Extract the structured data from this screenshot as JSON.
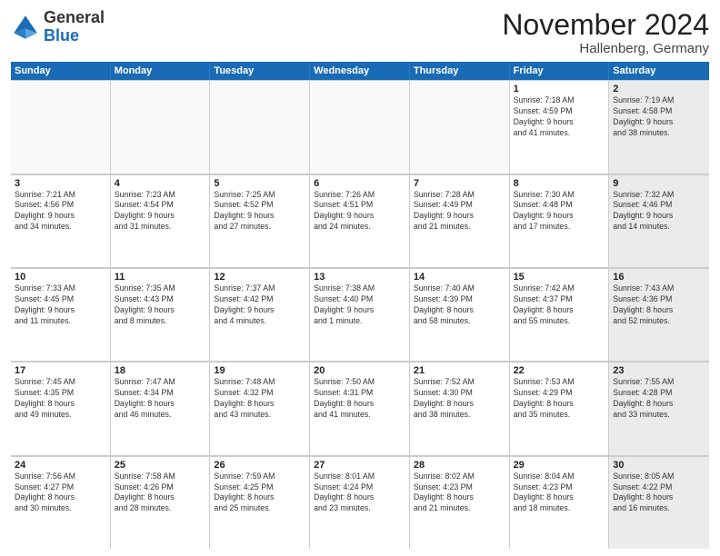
{
  "header": {
    "logo_general": "General",
    "logo_blue": "Blue",
    "month_title": "November 2024",
    "location": "Hallenberg, Germany"
  },
  "days_of_week": [
    "Sunday",
    "Monday",
    "Tuesday",
    "Wednesday",
    "Thursday",
    "Friday",
    "Saturday"
  ],
  "weeks": [
    [
      {
        "day": "",
        "info": "",
        "shaded": false,
        "empty": true
      },
      {
        "day": "",
        "info": "",
        "shaded": false,
        "empty": true
      },
      {
        "day": "",
        "info": "",
        "shaded": false,
        "empty": true
      },
      {
        "day": "",
        "info": "",
        "shaded": false,
        "empty": true
      },
      {
        "day": "",
        "info": "",
        "shaded": false,
        "empty": true
      },
      {
        "day": "1",
        "info": "Sunrise: 7:18 AM\nSunset: 4:59 PM\nDaylight: 9 hours\nand 41 minutes.",
        "shaded": false,
        "empty": false
      },
      {
        "day": "2",
        "info": "Sunrise: 7:19 AM\nSunset: 4:58 PM\nDaylight: 9 hours\nand 38 minutes.",
        "shaded": true,
        "empty": false
      }
    ],
    [
      {
        "day": "3",
        "info": "Sunrise: 7:21 AM\nSunset: 4:56 PM\nDaylight: 9 hours\nand 34 minutes.",
        "shaded": false,
        "empty": false
      },
      {
        "day": "4",
        "info": "Sunrise: 7:23 AM\nSunset: 4:54 PM\nDaylight: 9 hours\nand 31 minutes.",
        "shaded": false,
        "empty": false
      },
      {
        "day": "5",
        "info": "Sunrise: 7:25 AM\nSunset: 4:52 PM\nDaylight: 9 hours\nand 27 minutes.",
        "shaded": false,
        "empty": false
      },
      {
        "day": "6",
        "info": "Sunrise: 7:26 AM\nSunset: 4:51 PM\nDaylight: 9 hours\nand 24 minutes.",
        "shaded": false,
        "empty": false
      },
      {
        "day": "7",
        "info": "Sunrise: 7:28 AM\nSunset: 4:49 PM\nDaylight: 9 hours\nand 21 minutes.",
        "shaded": false,
        "empty": false
      },
      {
        "day": "8",
        "info": "Sunrise: 7:30 AM\nSunset: 4:48 PM\nDaylight: 9 hours\nand 17 minutes.",
        "shaded": false,
        "empty": false
      },
      {
        "day": "9",
        "info": "Sunrise: 7:32 AM\nSunset: 4:46 PM\nDaylight: 9 hours\nand 14 minutes.",
        "shaded": true,
        "empty": false
      }
    ],
    [
      {
        "day": "10",
        "info": "Sunrise: 7:33 AM\nSunset: 4:45 PM\nDaylight: 9 hours\nand 11 minutes.",
        "shaded": false,
        "empty": false
      },
      {
        "day": "11",
        "info": "Sunrise: 7:35 AM\nSunset: 4:43 PM\nDaylight: 9 hours\nand 8 minutes.",
        "shaded": false,
        "empty": false
      },
      {
        "day": "12",
        "info": "Sunrise: 7:37 AM\nSunset: 4:42 PM\nDaylight: 9 hours\nand 4 minutes.",
        "shaded": false,
        "empty": false
      },
      {
        "day": "13",
        "info": "Sunrise: 7:38 AM\nSunset: 4:40 PM\nDaylight: 9 hours\nand 1 minute.",
        "shaded": false,
        "empty": false
      },
      {
        "day": "14",
        "info": "Sunrise: 7:40 AM\nSunset: 4:39 PM\nDaylight: 8 hours\nand 58 minutes.",
        "shaded": false,
        "empty": false
      },
      {
        "day": "15",
        "info": "Sunrise: 7:42 AM\nSunset: 4:37 PM\nDaylight: 8 hours\nand 55 minutes.",
        "shaded": false,
        "empty": false
      },
      {
        "day": "16",
        "info": "Sunrise: 7:43 AM\nSunset: 4:36 PM\nDaylight: 8 hours\nand 52 minutes.",
        "shaded": true,
        "empty": false
      }
    ],
    [
      {
        "day": "17",
        "info": "Sunrise: 7:45 AM\nSunset: 4:35 PM\nDaylight: 8 hours\nand 49 minutes.",
        "shaded": false,
        "empty": false
      },
      {
        "day": "18",
        "info": "Sunrise: 7:47 AM\nSunset: 4:34 PM\nDaylight: 8 hours\nand 46 minutes.",
        "shaded": false,
        "empty": false
      },
      {
        "day": "19",
        "info": "Sunrise: 7:48 AM\nSunset: 4:32 PM\nDaylight: 8 hours\nand 43 minutes.",
        "shaded": false,
        "empty": false
      },
      {
        "day": "20",
        "info": "Sunrise: 7:50 AM\nSunset: 4:31 PM\nDaylight: 8 hours\nand 41 minutes.",
        "shaded": false,
        "empty": false
      },
      {
        "day": "21",
        "info": "Sunrise: 7:52 AM\nSunset: 4:30 PM\nDaylight: 8 hours\nand 38 minutes.",
        "shaded": false,
        "empty": false
      },
      {
        "day": "22",
        "info": "Sunrise: 7:53 AM\nSunset: 4:29 PM\nDaylight: 8 hours\nand 35 minutes.",
        "shaded": false,
        "empty": false
      },
      {
        "day": "23",
        "info": "Sunrise: 7:55 AM\nSunset: 4:28 PM\nDaylight: 8 hours\nand 33 minutes.",
        "shaded": true,
        "empty": false
      }
    ],
    [
      {
        "day": "24",
        "info": "Sunrise: 7:56 AM\nSunset: 4:27 PM\nDaylight: 8 hours\nand 30 minutes.",
        "shaded": false,
        "empty": false
      },
      {
        "day": "25",
        "info": "Sunrise: 7:58 AM\nSunset: 4:26 PM\nDaylight: 8 hours\nand 28 minutes.",
        "shaded": false,
        "empty": false
      },
      {
        "day": "26",
        "info": "Sunrise: 7:59 AM\nSunset: 4:25 PM\nDaylight: 8 hours\nand 25 minutes.",
        "shaded": false,
        "empty": false
      },
      {
        "day": "27",
        "info": "Sunrise: 8:01 AM\nSunset: 4:24 PM\nDaylight: 8 hours\nand 23 minutes.",
        "shaded": false,
        "empty": false
      },
      {
        "day": "28",
        "info": "Sunrise: 8:02 AM\nSunset: 4:23 PM\nDaylight: 8 hours\nand 21 minutes.",
        "shaded": false,
        "empty": false
      },
      {
        "day": "29",
        "info": "Sunrise: 8:04 AM\nSunset: 4:23 PM\nDaylight: 8 hours\nand 18 minutes.",
        "shaded": false,
        "empty": false
      },
      {
        "day": "30",
        "info": "Sunrise: 8:05 AM\nSunset: 4:22 PM\nDaylight: 8 hours\nand 16 minutes.",
        "shaded": true,
        "empty": false
      }
    ]
  ]
}
